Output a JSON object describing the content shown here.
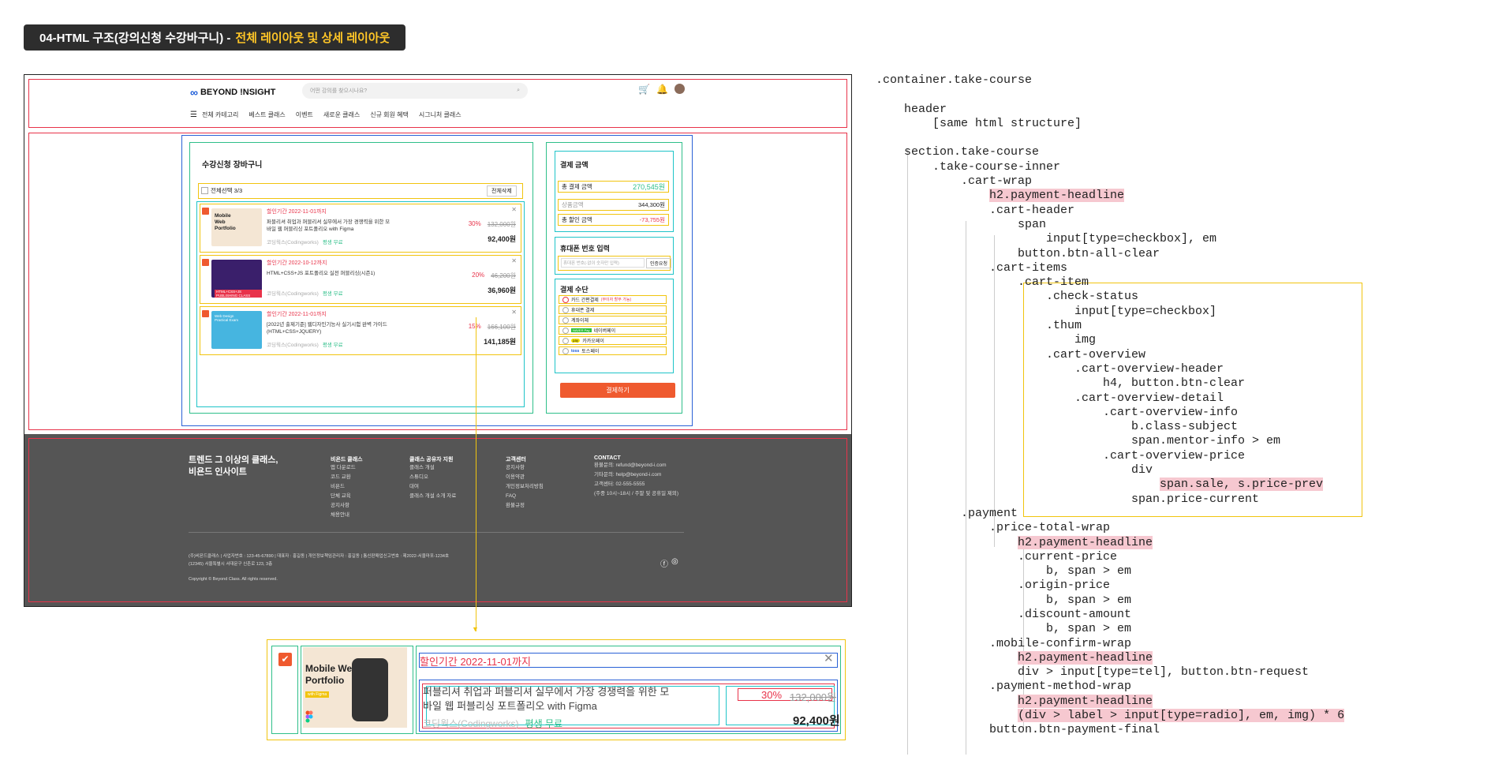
{
  "title": {
    "prefix": "04-HTML 구조(강의신청 수강바구니) -",
    "accent": "전체 레이아웃 및 상세 레이아웃"
  },
  "site": {
    "logo_text": "BEYOND !NSIGHT",
    "search_placeholder": "어떤 강의를 찾으시나요?",
    "nav": [
      "전체 카테고리",
      "베스트 클래스",
      "이벤트",
      "새로운 클래스",
      "신규 회원 혜택",
      "시그니처 클래스"
    ]
  },
  "cart": {
    "headline": "수강신청 장바구니",
    "select_all": "전체선택 3/3",
    "clear_all": "전체삭제",
    "items": [
      {
        "thumb_title": "Mobile Web Portfolio",
        "period": "할인기간 2022-11-01까지",
        "subject": "퍼블리셔 취업과 퍼블리셔 실무에서 가장 경쟁력을 위한 모바일 웹 퍼블리싱 포트폴리오 with Figma",
        "mentor": "코딩웍스(Codingworks)",
        "tag": "평생 무료",
        "sale": "30%",
        "prev": "132,000원",
        "current": "92,400원"
      },
      {
        "thumb_title": "HTML+CSS+JS PUBLISHING CLASS",
        "period": "할인기간 2022-10-12까지",
        "subject": "HTML+CSS+JS 포트폴리오 실전 퍼블리싱(시즌1)",
        "mentor": "코딩웍스(Codingworks)",
        "tag": "평생 무료",
        "sale": "20%",
        "prev": "46,200원",
        "current": "36,960원"
      },
      {
        "thumb_title": "Web Design Practical Exam",
        "period": "할인기간 2022-11-01까지",
        "subject": "[2022년 출제기준] 웹디자인기능사 실기시험 완벽 가이드 (HTML+CSS+JQUERY)",
        "mentor": "코딩웍스(Codingworks)",
        "tag": "평생 무료",
        "sale": "15%",
        "prev": "166,100원",
        "current": "141,185원"
      }
    ]
  },
  "payment": {
    "headline": "결제 금액",
    "total_label": "총 결제 금액",
    "total_value": "270,545원",
    "origin_label": "상품금액",
    "origin_value": "344,300원",
    "discount_label": "총 할인 금액",
    "discount_value": "-73,755원",
    "mobile_headline": "휴대폰 번호 입력",
    "mobile_placeholder": "휴대폰 번호(-없이 숫자만 입력)",
    "mobile_button": "인증요청",
    "method_headline": "결제 수단",
    "methods": [
      {
        "label": "카드 간편결제",
        "note": "(무이자 할부 가능)"
      },
      {
        "label": "휴대폰 결제",
        "note": ""
      },
      {
        "label": "계좌이체",
        "note": ""
      },
      {
        "label": "네이버페이",
        "note": "NAVER Pay"
      },
      {
        "label": "카카오페이",
        "note": "pay"
      },
      {
        "label": "토스페이",
        "note": "toss"
      }
    ],
    "final_button": "결제하기"
  },
  "footer": {
    "tagline_1": "트렌드 그 이상의 클래스,",
    "tagline_2": "비욘드 인사이트",
    "cols": [
      {
        "head": "비욘드 클래스",
        "links": [
          "앱 다운로드",
          "코드 교환",
          "비욘드",
          "단체 교육",
          "공지사항",
          "채용안내"
        ]
      },
      {
        "head": "클래스 공유자 지원",
        "links": [
          "클래스 개설",
          "스튜디오",
          "대여",
          "클래스 개설 소개 자료"
        ]
      },
      {
        "head": "고객센터",
        "links": [
          "공지사항",
          "이용약관",
          "개인정보처리방침",
          "FAQ",
          "환불규정"
        ]
      },
      {
        "head": "CONTACT",
        "links": [
          "환불문의: refund@beyond-i.com",
          "기타문의: help@beyond-i.com",
          "고객센터: 02-555-5555",
          "(주중 10시~18시 / 주말 및 공휴일 제외)"
        ]
      }
    ],
    "company_1": "(주)비욘드클래스 | 사업자번호 : 123-45-67890 | 대표자 : 홍길동 | 개인정보책임관리자 : 홍길동 | 통신판매업신고번호 : 제2022-서울마포-1234호",
    "company_2": "(12345) 서울특별시 서대문구 신촌로 123, 3층",
    "copyright": "Copyright © Beyond Class. All rights reserved."
  },
  "zoom": {
    "thumb_title_1": "Mobile Web",
    "thumb_title_2": "Portfolio",
    "thumb_badge": "with Figma",
    "period": "할인기간 2022-11-01까지",
    "subject_1": "퍼블리셔 취업과 퍼블리셔 실무에서 가장 경쟁력을 위한 모",
    "subject_2": "바일 웹 퍼블리싱 포트폴리오 with Figma",
    "mentor": "코딩웍스(Codingworks)",
    "tag": "평생 무료",
    "sale": "30%",
    "prev": "132,000원",
    "current": "92,400원"
  },
  "code": [
    {
      "t": ".container.take-course",
      "i": 0
    },
    {
      "t": "",
      "i": 0
    },
    {
      "t": "header",
      "i": 1
    },
    {
      "t": "[same html structure]",
      "i": 2
    },
    {
      "t": "",
      "i": 0
    },
    {
      "t": "section.take-course",
      "i": 1
    },
    {
      "t": ".take-course-inner",
      "i": 2
    },
    {
      "t": ".cart-wrap",
      "i": 3
    },
    {
      "t": "h2.payment-headline",
      "i": 4,
      "hl": true
    },
    {
      "t": ".cart-header",
      "i": 4
    },
    {
      "t": "span",
      "i": 5
    },
    {
      "t": "input[type=checkbox], em",
      "i": 6
    },
    {
      "t": "button.btn-all-clear",
      "i": 5
    },
    {
      "t": ".cart-items",
      "i": 4
    },
    {
      "t": ".cart-item",
      "i": 5
    },
    {
      "t": ".check-status",
      "i": 6
    },
    {
      "t": "input[type=checkbox]",
      "i": 7
    },
    {
      "t": ".thum",
      "i": 6
    },
    {
      "t": "img",
      "i": 7
    },
    {
      "t": ".cart-overview",
      "i": 6
    },
    {
      "t": ".cart-overview-header",
      "i": 7
    },
    {
      "t": "h4, button.btn-clear",
      "i": 8
    },
    {
      "t": ".cart-overview-detail",
      "i": 7
    },
    {
      "t": ".cart-overview-info",
      "i": 8
    },
    {
      "t": "b.class-subject",
      "i": 9
    },
    {
      "t": "span.mentor-info > em",
      "i": 9
    },
    {
      "t": ".cart-overview-price",
      "i": 8
    },
    {
      "t": "div",
      "i": 9
    },
    {
      "t": "span.sale, s.price-prev",
      "i": 10,
      "hl": true
    },
    {
      "t": "span.price-current",
      "i": 9
    },
    {
      "t": ".payment",
      "i": 3
    },
    {
      "t": ".price-total-wrap",
      "i": 4
    },
    {
      "t": "h2.payment-headline",
      "i": 5,
      "hl": true
    },
    {
      "t": ".current-price",
      "i": 5
    },
    {
      "t": "b, span > em",
      "i": 6
    },
    {
      "t": ".origin-price",
      "i": 5
    },
    {
      "t": "b, span > em",
      "i": 6
    },
    {
      "t": ".discount-amount",
      "i": 5
    },
    {
      "t": "b, span > em",
      "i": 6
    },
    {
      "t": ".mobile-confirm-wrap",
      "i": 4
    },
    {
      "t": "h2.payment-headline",
      "i": 5,
      "hl": true
    },
    {
      "t": "div > input[type=tel], button.btn-request",
      "i": 5
    },
    {
      "t": ".payment-method-wrap",
      "i": 4
    },
    {
      "t": "h2.payment-headline",
      "i": 5,
      "hl": true
    },
    {
      "t": "(div > label > input[type=radio], em, img) * 6",
      "i": 5,
      "hl": true
    },
    {
      "t": "button.btn-payment-final",
      "i": 4
    }
  ]
}
